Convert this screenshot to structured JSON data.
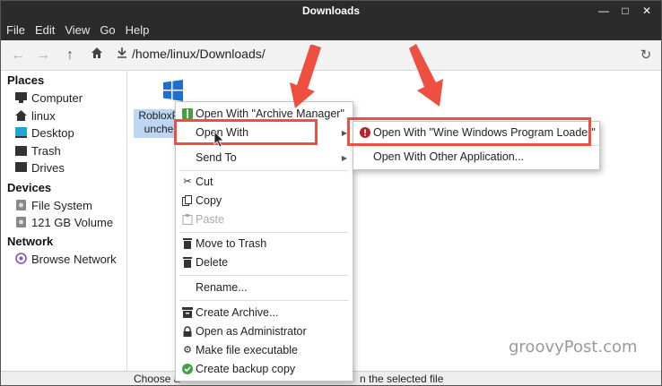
{
  "window": {
    "title": "Downloads"
  },
  "menubar": [
    "File",
    "Edit",
    "View",
    "Go",
    "Help"
  ],
  "toolbar": {
    "path": "/home/linux/Downloads/"
  },
  "sidebar": {
    "places_header": "Places",
    "places": [
      {
        "label": "Computer",
        "icon": "monitor-icon"
      },
      {
        "label": "linux",
        "icon": "home-icon"
      },
      {
        "label": "Desktop",
        "icon": "desktop-icon"
      },
      {
        "label": "Trash",
        "icon": "trash-icon"
      },
      {
        "label": "Drives",
        "icon": "drive-icon"
      }
    ],
    "devices_header": "Devices",
    "devices": [
      {
        "label": "File System",
        "icon": "disk-icon"
      },
      {
        "label": "121 GB Volume",
        "icon": "disk-icon"
      }
    ],
    "network_header": "Network",
    "network": [
      {
        "label": "Browse Network",
        "icon": "network-icon"
      }
    ]
  },
  "file": {
    "name_line1": "RobloxP",
    "name_line2": "unche"
  },
  "context_menu": {
    "open_with_archive": "Open With \"Archive Manager\"",
    "open_with": "Open With",
    "send_to": "Send To",
    "cut": "Cut",
    "copy": "Copy",
    "paste": "Paste",
    "move_to_trash": "Move to Trash",
    "delete": "Delete",
    "rename": "Rename...",
    "create_archive": "Create Archive...",
    "open_as_admin": "Open as Administrator",
    "make_executable": "Make file executable",
    "create_backup": "Create backup copy"
  },
  "submenu": {
    "wine_loader": "Open With \"Wine Windows Program Loader\"",
    "other_app": "Open With Other Application..."
  },
  "statusbar": {
    "left": "Choose a",
    "right": "n the selected file"
  },
  "watermark": "groovyPost.com",
  "colors": {
    "annotation": "#ee4f41",
    "selection": "#bcd6f3",
    "titlebar": "#2b2b2b"
  }
}
